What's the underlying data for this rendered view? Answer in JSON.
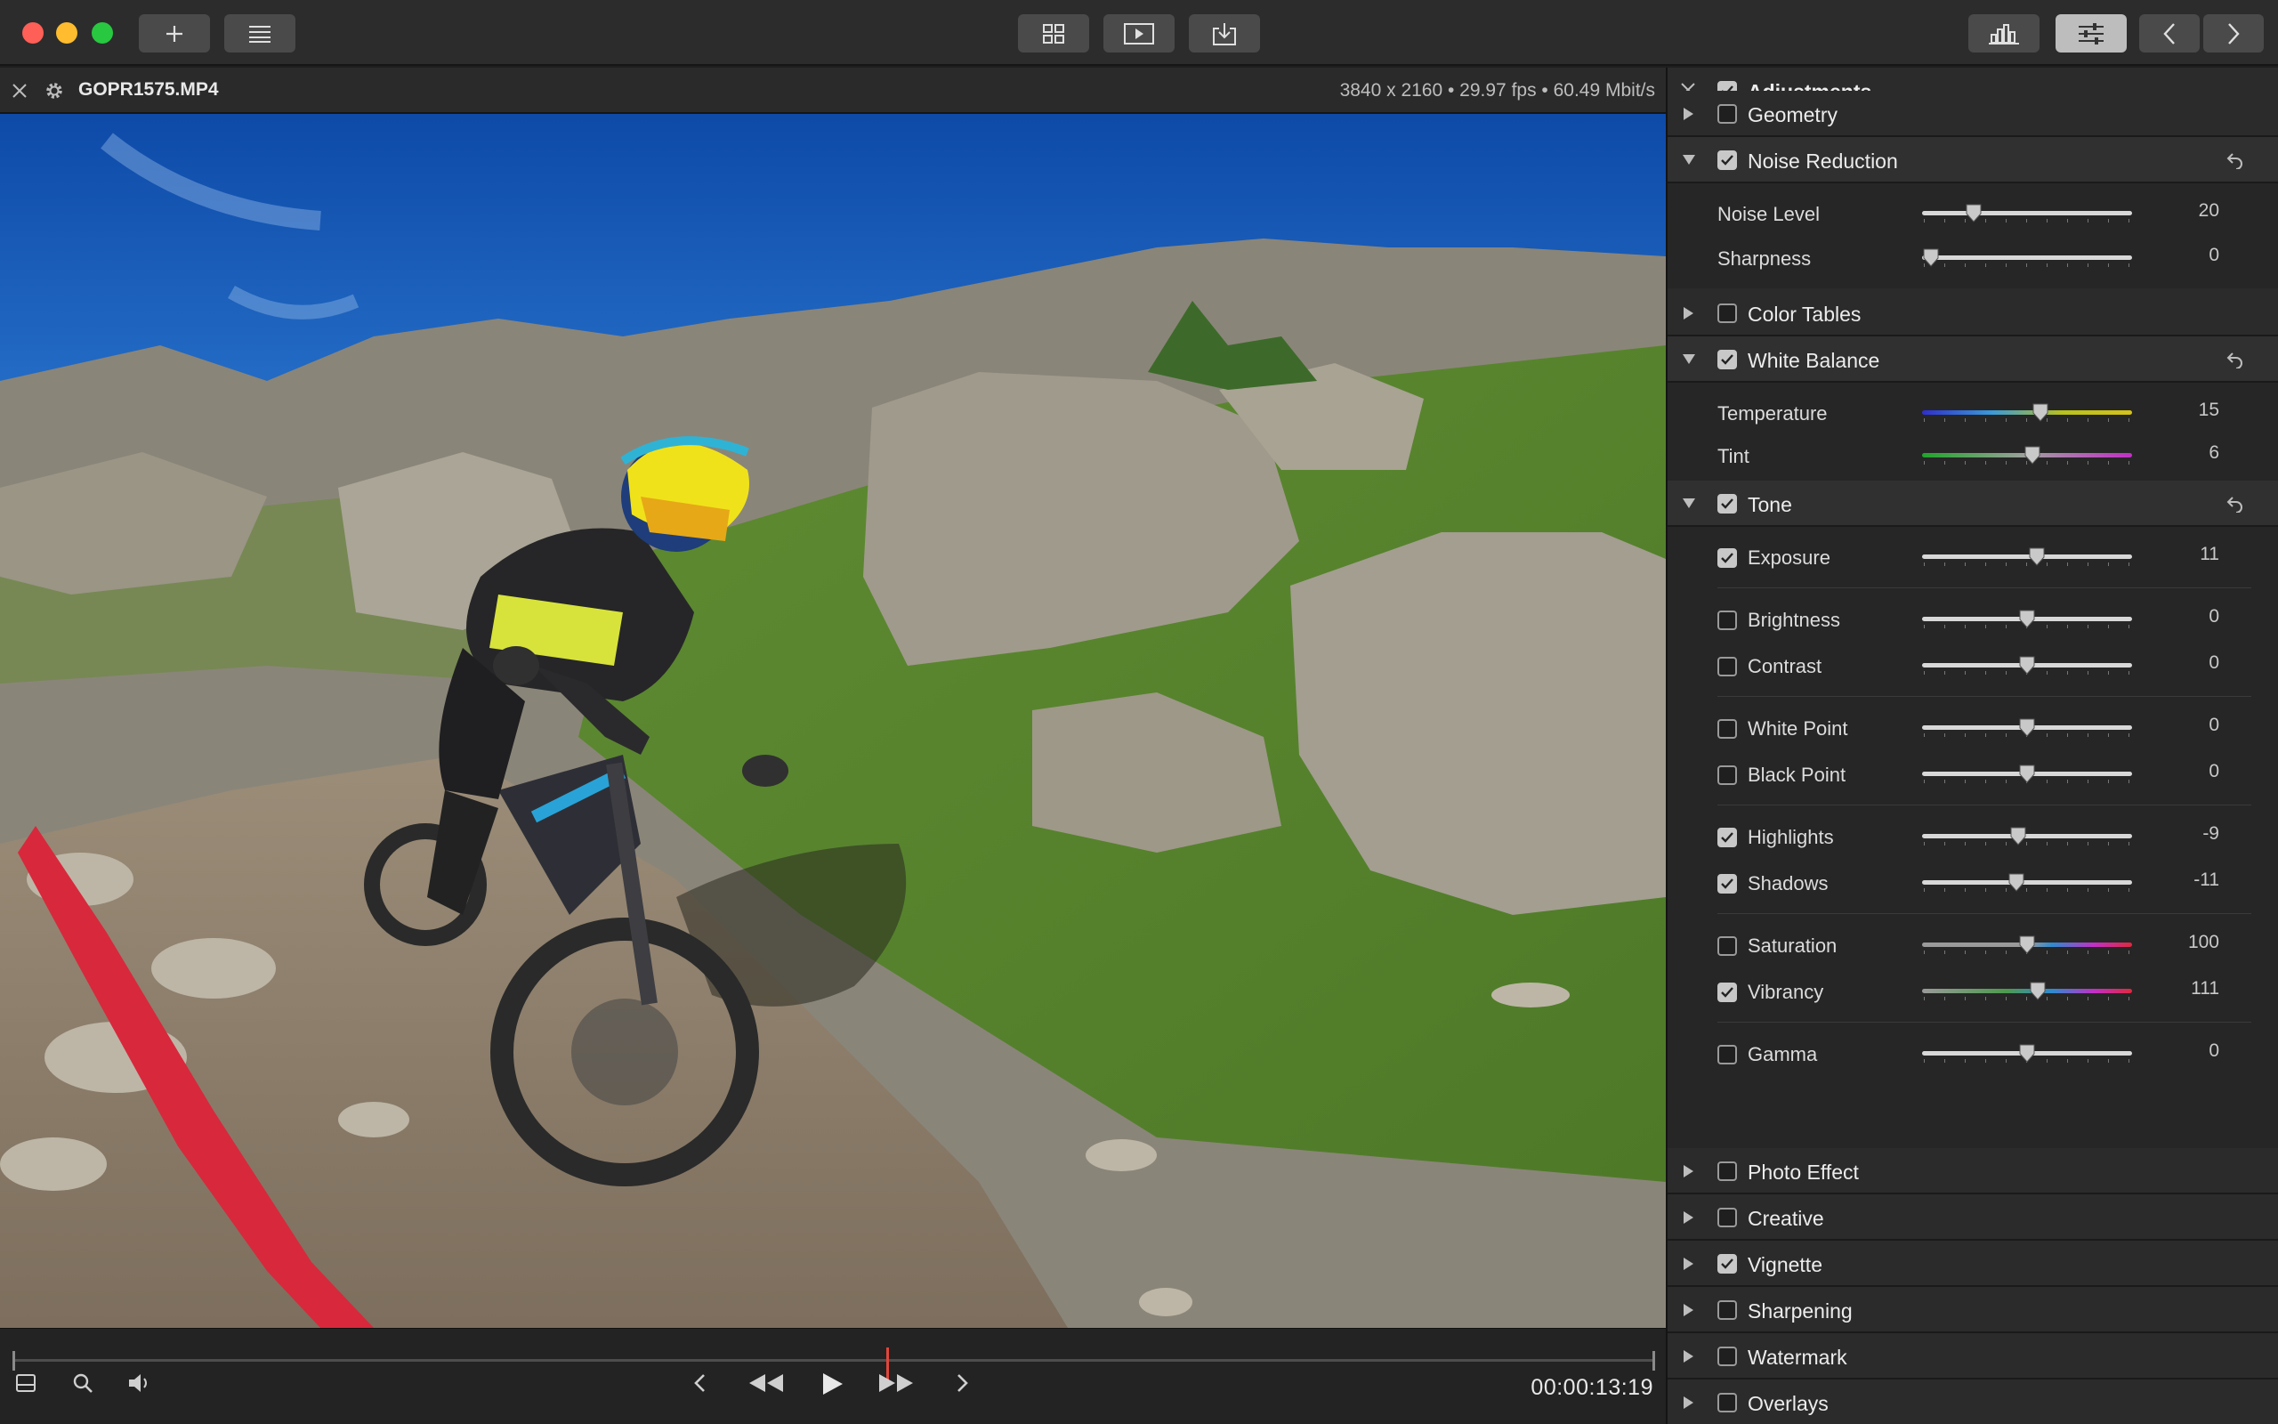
{
  "toolbar": {
    "buttons": [
      "plus-icon",
      "list-icon",
      "grid-icon",
      "play-icon",
      "import-icon",
      "histogram-icon",
      "adjustments-icon",
      "chevron-left-icon",
      "chevron-right-icon"
    ]
  },
  "file": {
    "name": "GOPR1575.MP4",
    "info": "3840 x 2160 • 29.97 fps • 60.49 Mbit/s"
  },
  "transport": {
    "timecode": "00:00:13:19",
    "playhead_fraction": 0.532
  },
  "panel": {
    "header": {
      "label": "Adjustments",
      "checked": true
    },
    "sections": {
      "geometry": {
        "label": "Geometry",
        "checked": false
      },
      "noise_reduction": {
        "label": "Noise Reduction",
        "checked": true
      },
      "color_tables": {
        "label": "Color Tables",
        "checked": false
      },
      "white_balance": {
        "label": "White Balance",
        "checked": true
      },
      "tone": {
        "label": "Tone",
        "checked": true
      },
      "photo_effect": {
        "label": "Photo Effect",
        "checked": false
      },
      "creative": {
        "label": "Creative",
        "checked": false
      },
      "vignette": {
        "label": "Vignette",
        "checked": true
      },
      "sharpening": {
        "label": "Sharpening",
        "checked": false
      },
      "watermark": {
        "label": "Watermark",
        "checked": false
      },
      "overlays": {
        "label": "Overlays",
        "checked": false
      }
    },
    "noise": {
      "noise_level": {
        "label": "Noise Level",
        "value": "20",
        "fraction": 0.22
      },
      "sharpness": {
        "label": "Sharpness",
        "value": "0",
        "fraction": 0.0
      }
    },
    "wb": {
      "temperature": {
        "label": "Temperature",
        "value": "15",
        "fraction": 0.57
      },
      "tint": {
        "label": "Tint",
        "value": "6",
        "fraction": 0.53
      }
    },
    "tone": {
      "exposure": {
        "label": "Exposure",
        "value": "11",
        "checked": true,
        "fraction": 0.55
      },
      "brightness": {
        "label": "Brightness",
        "value": "0",
        "checked": false,
        "fraction": 0.5
      },
      "contrast": {
        "label": "Contrast",
        "value": "0",
        "checked": false,
        "fraction": 0.5
      },
      "white_point": {
        "label": "White Point",
        "value": "0",
        "checked": false,
        "fraction": 0.5
      },
      "black_point": {
        "label": "Black Point",
        "value": "0",
        "checked": false,
        "fraction": 0.5
      },
      "highlights": {
        "label": "Highlights",
        "value": "-9",
        "checked": true,
        "fraction": 0.455
      },
      "shadows": {
        "label": "Shadows",
        "value": "-11",
        "checked": true,
        "fraction": 0.445
      },
      "saturation": {
        "label": "Saturation",
        "value": "100",
        "checked": false,
        "fraction": 0.5
      },
      "vibrancy": {
        "label": "Vibrancy",
        "value": "111",
        "checked": true,
        "fraction": 0.555
      },
      "gamma": {
        "label": "Gamma",
        "value": "0",
        "checked": false,
        "fraction": 0.5
      }
    }
  },
  "colors": {
    "playhead": "#e0463b",
    "checkbox_on": "#c8c8c8",
    "close": "#fe5f57",
    "minimize": "#febc2e",
    "maximize": "#28c840"
  }
}
